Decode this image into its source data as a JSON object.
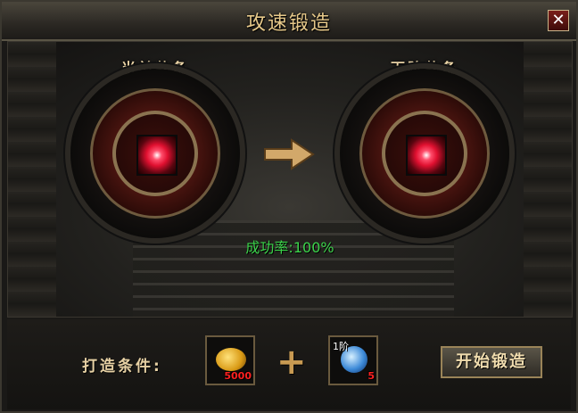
{
  "window": {
    "title": "攻速锻造",
    "close_label": "✕"
  },
  "current": {
    "label": "当前装备"
  },
  "next": {
    "label": "下阶装备"
  },
  "success": {
    "label": "成功率:",
    "value": "100%"
  },
  "requirements": {
    "label": "打造条件:",
    "gold": {
      "count": "5000"
    },
    "stone": {
      "tier": "1阶",
      "count": "5"
    }
  },
  "plus_label": "+",
  "start_button": {
    "label": "开始锻造"
  }
}
